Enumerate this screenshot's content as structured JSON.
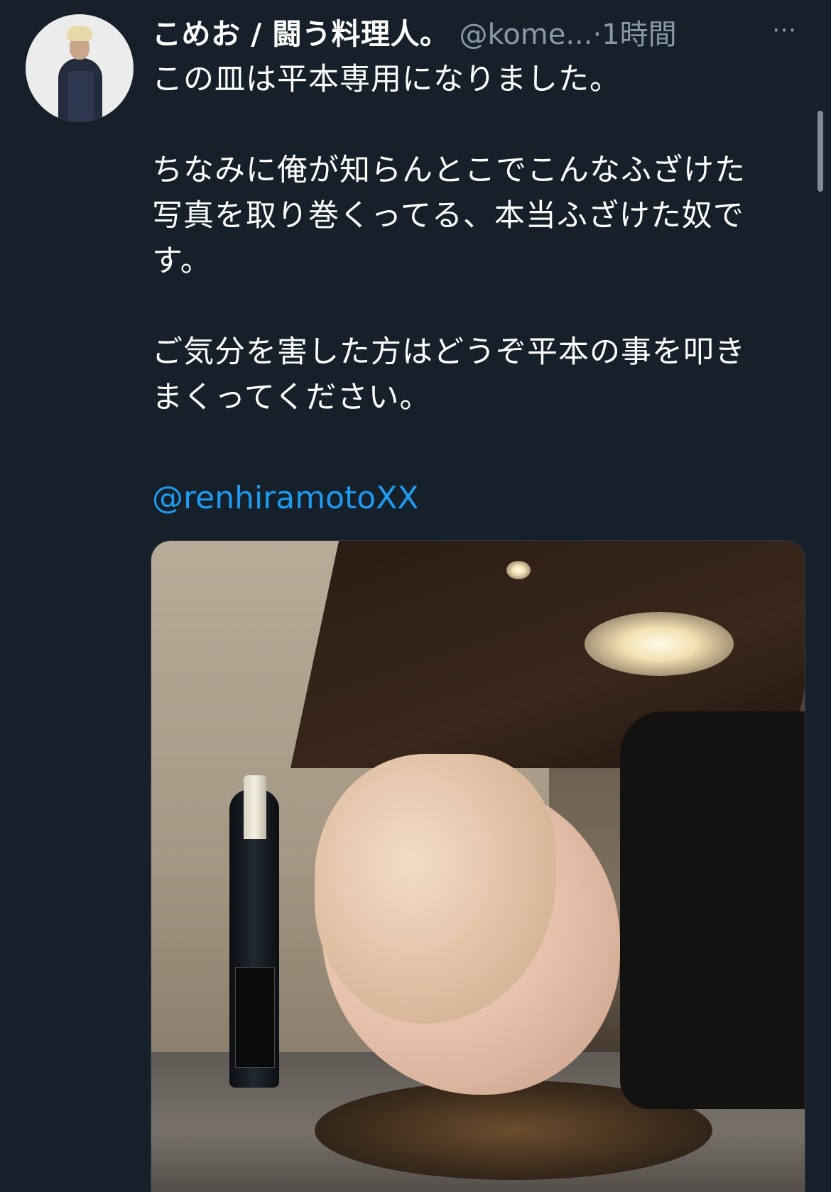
{
  "tweet": {
    "author_name": "こめお / 闘う料理人。",
    "handle": "@kome...",
    "separator": "·",
    "time": "1時間",
    "more_icon": "⋯",
    "lines": [
      "この皿は平本専用になりました。",
      "",
      "ちなみに俺が知らんとこでこんなふざけた",
      "写真を取り巻くってる、本当ふざけた奴で",
      "す。",
      "",
      "ご気分を害した方はどうぞ平本の事を叩き",
      "まくってください。"
    ],
    "mention": "@renhiramotoXX"
  },
  "colors": {
    "background": "#15202b",
    "text": "#ffffff",
    "secondary": "#8b98a5",
    "link": "#1d9bf0"
  },
  "icons": {
    "more": "more-horizontal-icon"
  }
}
